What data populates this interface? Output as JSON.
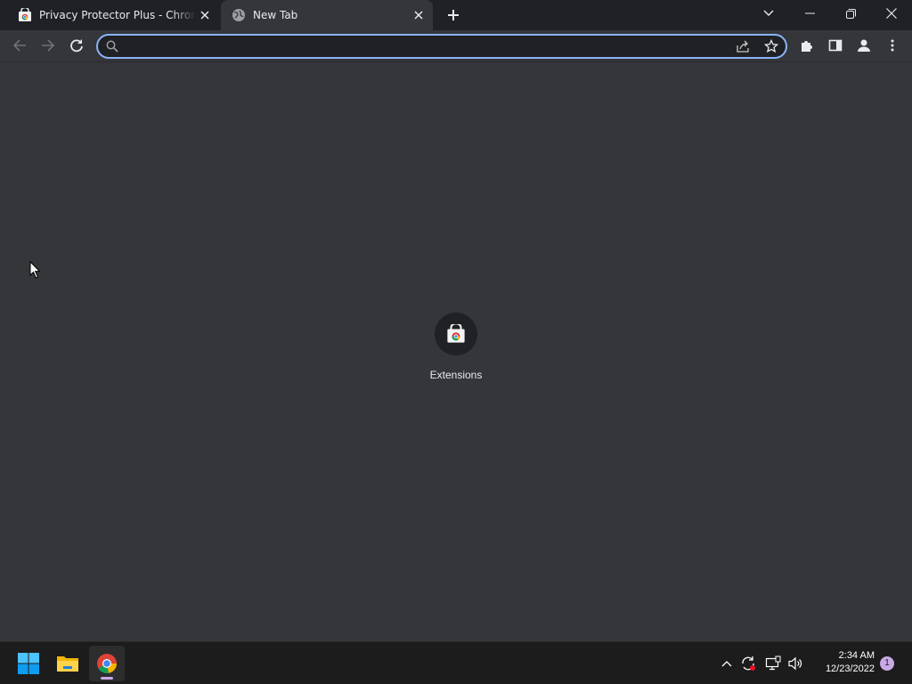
{
  "browser": {
    "tabs": [
      {
        "title": "Privacy Protector Plus - Chrome Web Store",
        "active": false,
        "favicon": "web-store-icon"
      },
      {
        "title": "New Tab",
        "active": true,
        "favicon": "globe-icon"
      }
    ],
    "omnibox": {
      "value": "",
      "placeholder": ""
    },
    "accent_color": "#8ab4f8"
  },
  "new_tab_page": {
    "shortcuts": [
      {
        "label": "Extensions",
        "icon": "web-store-icon"
      }
    ]
  },
  "taskbar": {
    "apps": [
      {
        "name": "start-icon"
      },
      {
        "name": "file-explorer-icon"
      },
      {
        "name": "chrome-icon",
        "running": true
      }
    ],
    "clock": {
      "time": "2:34 AM",
      "date": "12/23/2022"
    },
    "notification_count": "1"
  }
}
